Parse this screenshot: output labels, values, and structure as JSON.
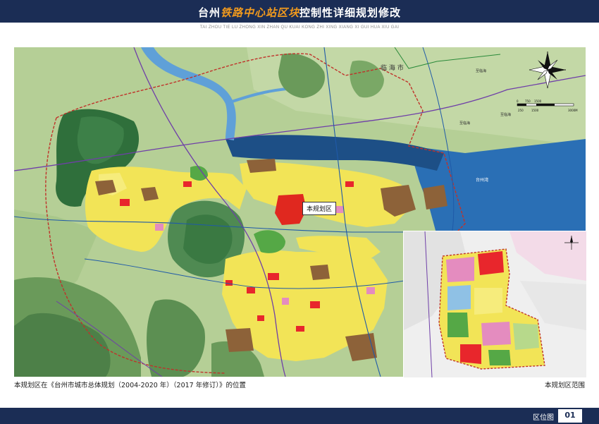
{
  "header": {
    "title_prefix": "台州",
    "title_highlight": "铁路中心站区块",
    "title_suffix": "控制性详细规划修改",
    "subtitle": "TAI ZHOU TIE LU ZHONG XIN ZHAN QU KUAI KONG ZHI XING XIANG XI GUI HUA XIU GAI"
  },
  "map": {
    "labels": {
      "linhai": "临 海 市",
      "to_linhai_1": "至临海",
      "to_linhai_2": "至临海",
      "to_linhai_3": "至临海",
      "taizhou_bay": "台州湾"
    },
    "callout": "本规划区",
    "scale": {
      "t0": "0",
      "t1": "750",
      "t2": "1500",
      "t3": "3000M",
      "b0": "250",
      "b1": "1500"
    },
    "colors": {
      "water": "#1d4f86",
      "sea": "#2a6fb5",
      "river": "#5fa0d8",
      "mountain": "#2f6f3b",
      "hill": "#6a9a5a",
      "farmland": "#a9c98a",
      "residential": "#f2e457",
      "commercial": "#e8262c",
      "industrial": "#8d6239",
      "public": "#e48cbf",
      "green": "#55a846",
      "plan_area": "#e0281f",
      "boundary": "#c0322a"
    }
  },
  "captions": {
    "left": "本规划区在《台州市城市总体规划（2004-2020 年）（2017 年修订）》的位置",
    "right": "本规划区范围"
  },
  "footer": {
    "label": "区位图",
    "page_number": "01"
  }
}
